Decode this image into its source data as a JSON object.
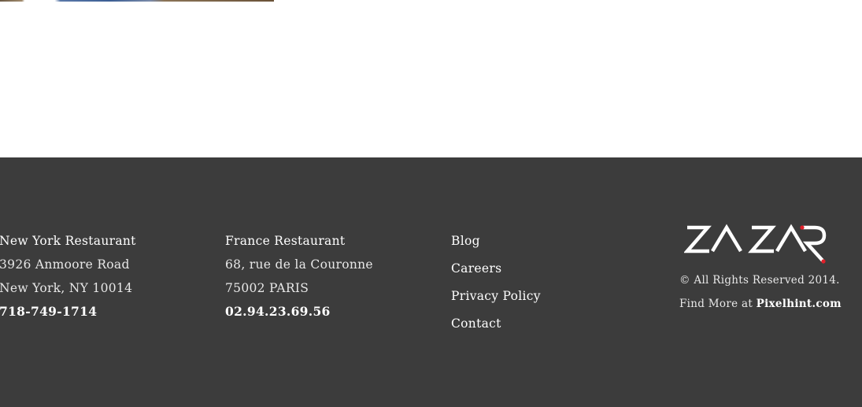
{
  "footer": {
    "new_york": {
      "title": "New York Restaurant",
      "address1": "3926 Anmoore Road",
      "address2": "New York, NY 10014",
      "phone": "718-749-1714"
    },
    "france": {
      "title": "France Restaurant",
      "address1": "68, rue  de la Couronne",
      "address2": "75002 PARIS",
      "phone": "02.94.23.69.56"
    },
    "links": [
      {
        "label": "Blog"
      },
      {
        "label": "Careers"
      },
      {
        "label": "Privacy Policy"
      },
      {
        "label": "Contact"
      }
    ],
    "brand": {
      "logo_text": "ZA ZAR",
      "copyright": "© All Rights Reserved 2014.",
      "find_more_prefix": "Find  More at ",
      "find_more_link": "Pixelhint.com"
    }
  },
  "colors": {
    "footer_bg": "#3c3c3c",
    "text": "#e8e8e8",
    "logo_dot": "#e0202a"
  }
}
